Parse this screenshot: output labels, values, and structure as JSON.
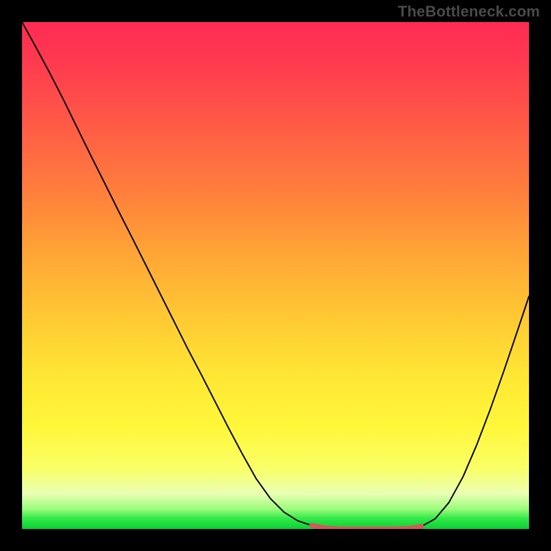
{
  "watermark": {
    "text": "TheBottleneck.com"
  },
  "chart_data": {
    "type": "line",
    "title": "",
    "xlabel": "",
    "ylabel": "",
    "xlim": [
      0,
      1
    ],
    "ylim": [
      0,
      1
    ],
    "gradient_stops": [
      {
        "pos": 0.0,
        "color": "#ff2b53"
      },
      {
        "pos": 0.08,
        "color": "#ff3a4f"
      },
      {
        "pos": 0.2,
        "color": "#ff5a46"
      },
      {
        "pos": 0.34,
        "color": "#ff803c"
      },
      {
        "pos": 0.46,
        "color": "#ffa636"
      },
      {
        "pos": 0.58,
        "color": "#ffc833"
      },
      {
        "pos": 0.7,
        "color": "#ffe734"
      },
      {
        "pos": 0.8,
        "color": "#fff73a"
      },
      {
        "pos": 0.88,
        "color": "#faff66"
      },
      {
        "pos": 0.93,
        "color": "#eaffb4"
      },
      {
        "pos": 0.96,
        "color": "#9dfc7d"
      },
      {
        "pos": 0.98,
        "color": "#2fe847"
      },
      {
        "pos": 1.0,
        "color": "#0ad134"
      }
    ],
    "series": [
      {
        "name": "bottleneck-curve",
        "stroke": "#000000",
        "stroke_width": 2,
        "x": [
          0.0,
          0.027,
          0.054,
          0.082,
          0.109,
          0.136,
          0.163,
          0.19,
          0.218,
          0.245,
          0.272,
          0.299,
          0.326,
          0.354,
          0.381,
          0.408,
          0.435,
          0.462,
          0.49,
          0.517,
          0.544,
          0.571,
          0.598,
          0.626,
          0.652,
          0.679,
          0.707,
          0.734,
          0.761,
          0.788,
          0.815,
          0.842,
          0.87,
          0.897,
          0.924,
          0.951,
          0.978,
          1.0
        ],
        "y": [
          1.0,
          0.951,
          0.901,
          0.846,
          0.791,
          0.736,
          0.682,
          0.628,
          0.573,
          0.519,
          0.465,
          0.411,
          0.357,
          0.304,
          0.251,
          0.198,
          0.147,
          0.099,
          0.06,
          0.033,
          0.016,
          0.007,
          0.002,
          0.0,
          0.0,
          0.0,
          0.0,
          0.0,
          0.001,
          0.005,
          0.02,
          0.052,
          0.103,
          0.166,
          0.237,
          0.313,
          0.393,
          0.459
        ]
      },
      {
        "name": "highlight-flat",
        "stroke": "#d25a5a",
        "stroke_width": 7,
        "x": [
          0.571,
          0.598,
          0.626,
          0.652,
          0.679,
          0.707,
          0.734,
          0.761,
          0.788
        ],
        "y": [
          0.007,
          0.002,
          0.0,
          0.0,
          0.0,
          0.0,
          0.0,
          0.001,
          0.005
        ]
      }
    ]
  }
}
